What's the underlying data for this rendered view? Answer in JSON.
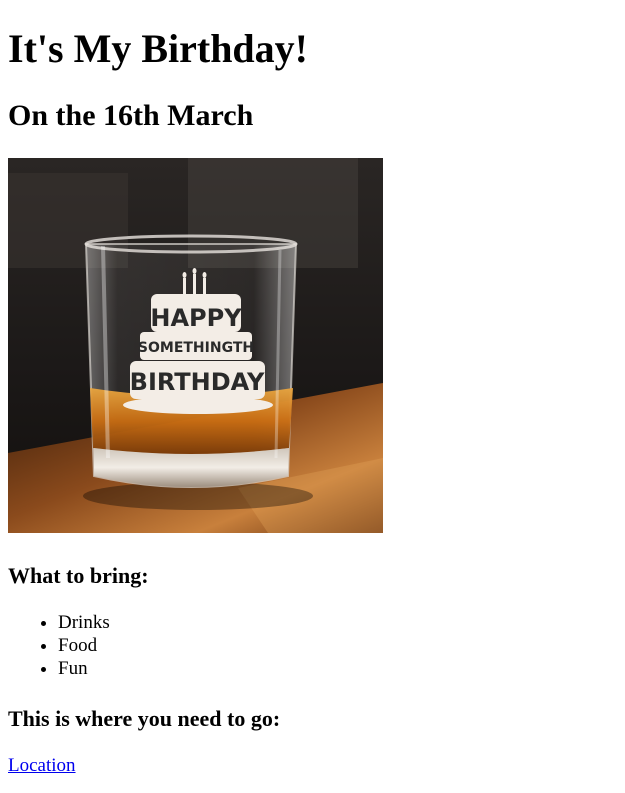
{
  "header": {
    "title": "It's My Birthday!",
    "subtitle": "On the 16th March"
  },
  "photo": {
    "etched_text": {
      "line1": "HAPPY",
      "line2": "SOMETHINGTH",
      "line3": "BIRTHDAY"
    }
  },
  "bring": {
    "heading": "What to bring:",
    "items": [
      "Drinks",
      "Food",
      "Fun"
    ]
  },
  "directions": {
    "heading": "This is where you need to go:",
    "link_label": "Location"
  },
  "colors": {
    "link": "#0000ee",
    "text": "#000000"
  }
}
